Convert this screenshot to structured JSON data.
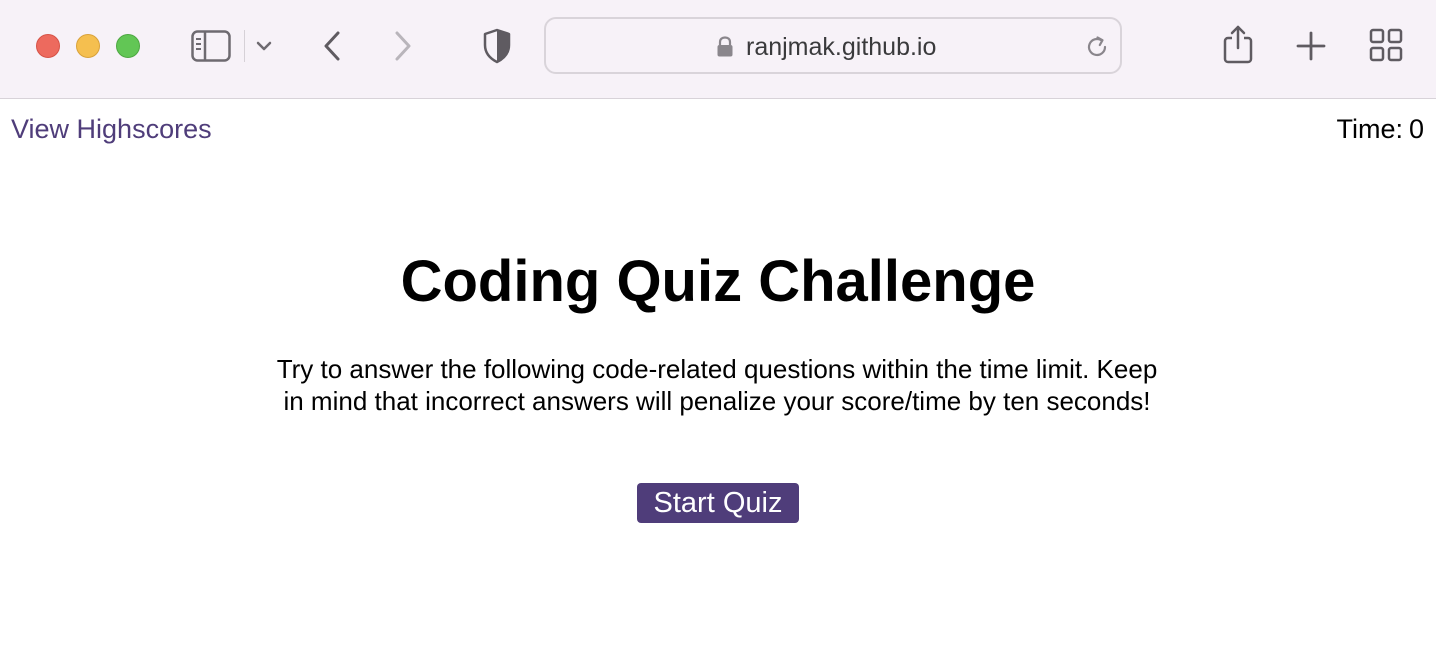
{
  "browser": {
    "url": "ranjmak.github.io",
    "icons": [
      "close-window",
      "minimize-window",
      "maximize-window",
      "sidebar-icon",
      "chevron-down-icon",
      "back-icon",
      "forward-icon",
      "privacy-shield-icon",
      "lock-icon",
      "reload-icon",
      "share-icon",
      "new-tab-icon",
      "tab-overview-icon"
    ]
  },
  "header": {
    "highscores_link": "View Highscores",
    "timer_label": "Time:",
    "timer_value": "0"
  },
  "main": {
    "title": "Coding Quiz Challenge",
    "intro": "Try to answer the following code-related questions within the time limit. Keep in mind that incorrect answers will penalize your score/time by ten seconds!",
    "start_button": "Start Quiz"
  },
  "colors": {
    "accent": "#4f3d7a",
    "toolbar_bg": "#f7f2f8"
  }
}
